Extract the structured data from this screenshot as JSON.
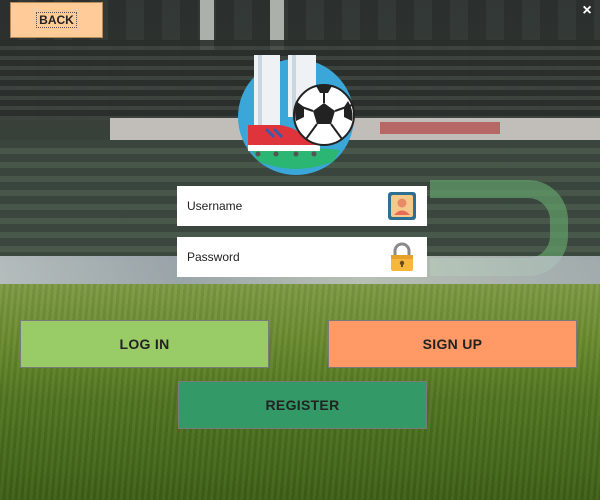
{
  "window": {
    "close_symbol": "×"
  },
  "header": {
    "back_label": "BACK"
  },
  "logo": {
    "icon": "soccer-logo-icon"
  },
  "login_form": {
    "username": {
      "placeholder": "Username",
      "value": "",
      "icon": "user-card-icon"
    },
    "password": {
      "placeholder": "Password",
      "value": "",
      "icon": "padlock-icon"
    }
  },
  "actions": {
    "login_label": "LOG IN",
    "signup_label": "SIGN UP",
    "register_label": "REGISTER"
  },
  "colors": {
    "back_button": "#ffcc99",
    "login_button": "#99cc66",
    "signup_button": "#ff9966",
    "register_button": "#339966"
  }
}
